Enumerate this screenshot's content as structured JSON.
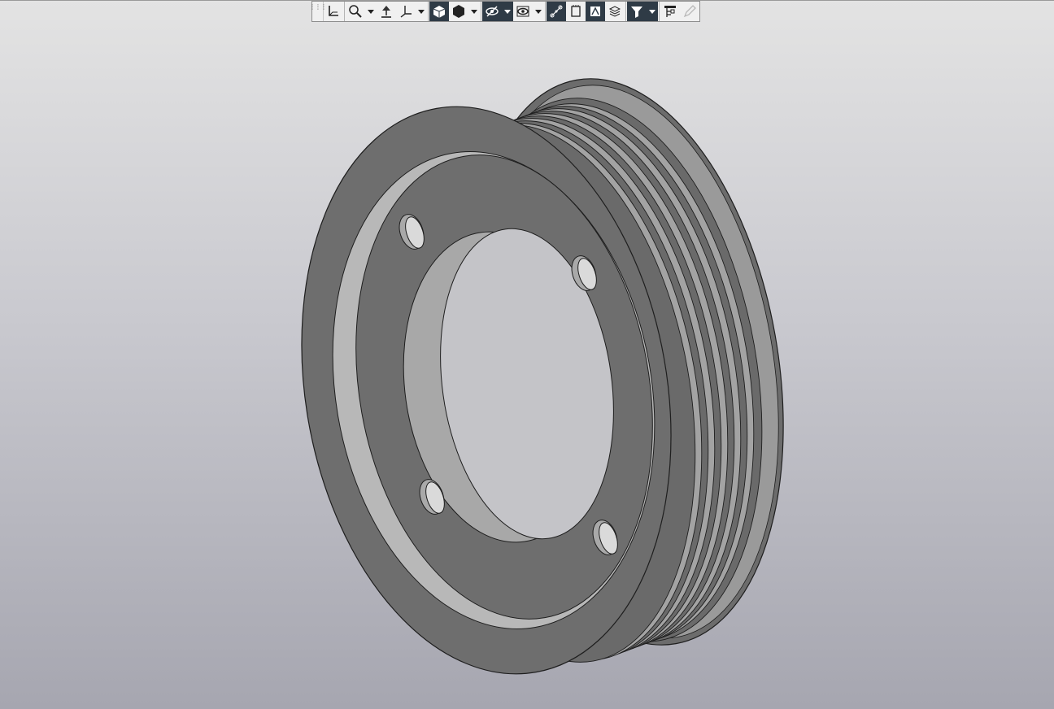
{
  "window": {
    "background_top": "#e3e3e3",
    "background_bottom": "#a6a6b0"
  },
  "toolbar": {
    "accent_pressed": "#2f3b46",
    "items": [
      {
        "icon": "grip-icon"
      },
      {
        "icon": "orientation-icon"
      },
      {
        "icon": "zoom-icon",
        "dropdown": true
      },
      {
        "icon": "rotate-view-icon"
      },
      {
        "icon": "axes-icon",
        "dropdown": true
      },
      {
        "icon": "shaded-cube-icon",
        "pressed": true
      },
      {
        "icon": "solid-hexagon-icon",
        "dropdown": true
      },
      {
        "icon": "hide-icon",
        "pressed": true,
        "dropdown": true
      },
      {
        "icon": "show-icon",
        "dropdown": true
      },
      {
        "icon": "constraints-icon",
        "pressed": true
      },
      {
        "icon": "layers-icon"
      },
      {
        "icon": "section-view-icon",
        "pressed": true
      },
      {
        "icon": "stack-view-icon"
      },
      {
        "icon": "filter-icon",
        "pressed": true,
        "dropdown": true
      },
      {
        "icon": "tree-settings-icon"
      },
      {
        "icon": "pencil-icon",
        "disabled": true
      }
    ]
  },
  "model": {
    "name_icon": "pulley-part",
    "face_color": "#6e6e6e",
    "highlight_color": "#bdbdbd",
    "edge_color": "#1f1f1f",
    "bolt_holes": 4,
    "grooves": 6
  }
}
